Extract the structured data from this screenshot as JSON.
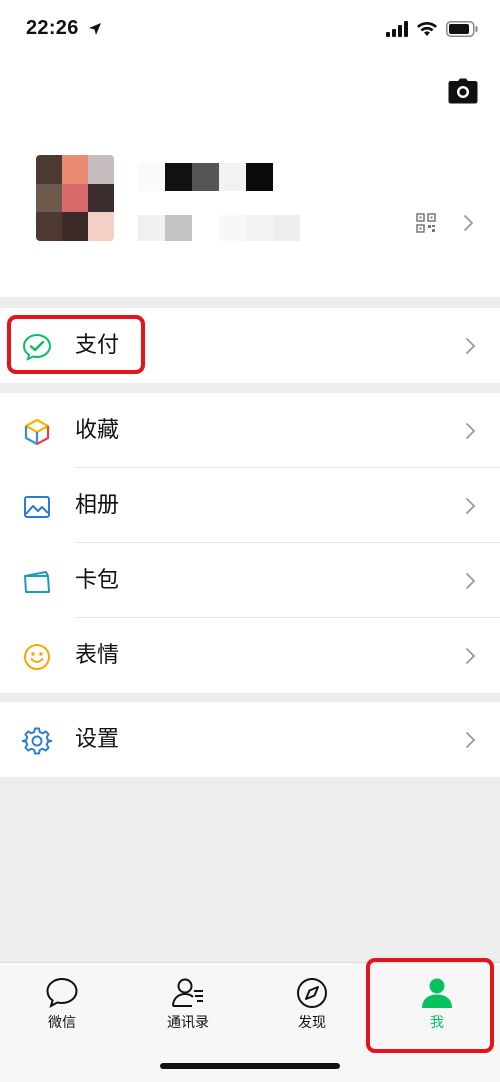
{
  "status_bar": {
    "time": "22:26"
  },
  "menu": {
    "pay": {
      "label": "支付"
    },
    "favorites": {
      "label": "收藏"
    },
    "album": {
      "label": "相册"
    },
    "cards": {
      "label": "卡包"
    },
    "stickers": {
      "label": "表情"
    },
    "settings": {
      "label": "设置"
    }
  },
  "tabbar": {
    "tabs": [
      {
        "label": "微信",
        "icon": "chat-bubble-icon"
      },
      {
        "label": "通讯录",
        "icon": "contacts-icon"
      },
      {
        "label": "发现",
        "icon": "compass-icon"
      },
      {
        "label": "我",
        "icon": "person-icon",
        "active": true
      }
    ]
  },
  "colors": {
    "brand_green": "#07c160",
    "highlight_red": "#e3141b",
    "background": "#ededed"
  }
}
